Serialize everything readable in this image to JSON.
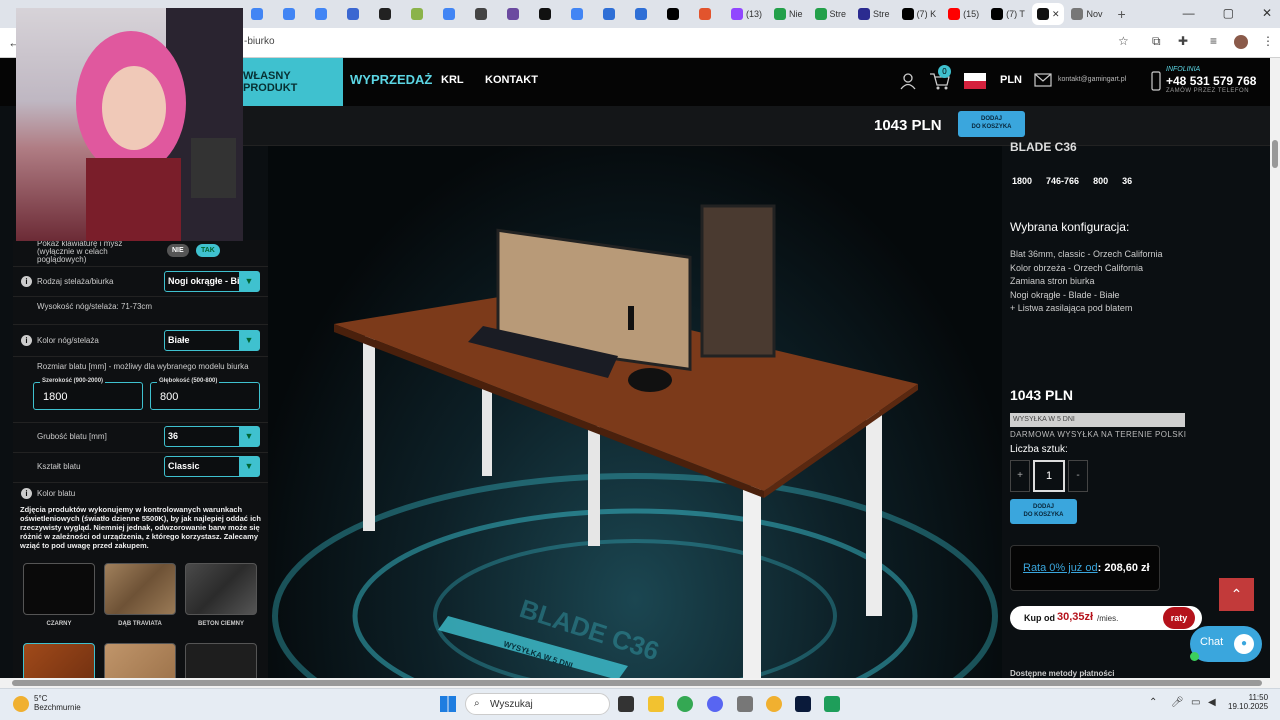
{
  "browser": {
    "tabs": [
      {
        "label": "",
        "color": "#4285f4"
      },
      {
        "label": "",
        "color": "#4285f4"
      },
      {
        "label": "",
        "color": "#4285f4"
      },
      {
        "label": "",
        "color": "#3b67d1"
      },
      {
        "label": "",
        "color": "#222222"
      },
      {
        "label": "",
        "color": "#8bb34a"
      },
      {
        "label": "",
        "color": "#4285f4"
      },
      {
        "label": "",
        "color": "#444444"
      },
      {
        "label": "",
        "color": "#6b4aa0"
      },
      {
        "label": "",
        "color": "#111111"
      },
      {
        "label": "",
        "color": "#4285f4"
      },
      {
        "label": "",
        "color": "#2f6fd6"
      },
      {
        "label": "",
        "color": "#2f6fd6"
      },
      {
        "label": "",
        "color": "#000000"
      },
      {
        "label": "",
        "color": "#e2542d"
      },
      {
        "label": "(13)",
        "color": "#9146ff"
      },
      {
        "label": "Nie",
        "color": "#23a04a"
      },
      {
        "label": "Stre",
        "color": "#23a04a"
      },
      {
        "label": "Stre",
        "color": "#2b2b90"
      },
      {
        "label": "(7) K",
        "color": "#000000"
      },
      {
        "label": "(15)",
        "color": "#ff0000"
      },
      {
        "label": "(7) T",
        "color": "#000000"
      },
      {
        "label": "",
        "color": "#111111"
      },
      {
        "label": "Nov",
        "color": "#777777"
      }
    ],
    "url": "-biurko",
    "new_tab": "+"
  },
  "nav": {
    "own_product": "WŁASNY PRODUKT",
    "sale": "WYPRZEDAŻ",
    "krl": "KRL",
    "contact": "KONTAKT",
    "cart_count": "0",
    "currency": "PLN",
    "email": "kontakt@gamingart.pl",
    "hotline_label": "INFOLINIA",
    "phone": "+48 531 579 768",
    "phone_sub": "ZAMÓW PRZEZ TELEFON"
  },
  "sticky": {
    "price": "1043 PLN",
    "add_top": "DODAJ",
    "add_bottom": "DO KOSZYKA"
  },
  "config": {
    "keyboard_label": "Pokaż klawiaturę i mysz (wyłącznie w celach poglądowych)",
    "keyboard_no": "NIE",
    "keyboard_yes": "TAK",
    "frame_label": "Rodzaj stelaża/biurka",
    "frame_value": "Nogi okrągłe - Bi",
    "height_note": "Wysokość nóg/stelaża: 71-73cm",
    "legs_color_label": "Kolor nóg/stelaża",
    "legs_color_value": "Białe",
    "size_label": "Rozmiar blatu [mm] - możliwy dla wybranego modelu biurka",
    "width_label": "Szerokość (900-2000)",
    "width_value": "1800",
    "depth_label": "Głębokość (500-800)",
    "depth_value": "800",
    "thickness_label": "Grubość blatu [mm]",
    "thickness_value": "36",
    "shape_label": "Kształt blatu",
    "shape_value": "Classic",
    "top_color_label": "Kolor blatu",
    "disclaimer": "Zdjęcia produktów wykonujemy w kontrolowanych warunkach oświetleniowych (światło dzienne 5500K), by jak najlepiej oddać ich rzeczywisty wygląd. Niemniej jednak, odwzorowanie barw może się różnić w zależności od urządzenia, z którego korzystasz. Zalecamy wziąć to pod uwagę przed zakupem.",
    "swatches": [
      {
        "name": "CZARNY",
        "color": "#0a0a0a"
      },
      {
        "name": "DĄB TRAVIATA",
        "color": "#8a6a48"
      },
      {
        "name": "BETON CIEMNY",
        "color": "#3a3a3a"
      }
    ]
  },
  "product": {
    "model": "BLADE C36",
    "dims": [
      "1800",
      "746-766",
      "800",
      "36"
    ],
    "selected_heading": "Wybrana konfiguracja:",
    "selected_lines": [
      "Blat 36mm, classic - Orzech California",
      "Kolor obrzeża - Orzech California",
      "Zamiana stron biurka",
      "Nogi okrągłe - Blade - Białe",
      "+ Listwa zasilająca pod blatem"
    ],
    "price": "1043 PLN",
    "shipping": "WYSYŁKA W 5 DNI",
    "free_shipping": "DARMOWA WYSYŁKA NA TERENIE POLSKI",
    "qty_label": "Liczba sztuk:",
    "qty_minus": "+",
    "qty_value": "1",
    "qty_plus": "-",
    "add_top": "DODAJ",
    "add_bottom": "DO KOSZYKA",
    "rata_link": "Rata 0% już od",
    "rata_value": ": 208,60 zł",
    "kup_label": "Kup od",
    "kup_value": "30,35zł",
    "kup_unit": "/mies.",
    "raty": "raty",
    "payment_methods": "Dostępne metody płatności",
    "chat": "Chat",
    "floor_banner": "BLADE C36",
    "floor_ribbon": "WYSYŁKA W 5 DNI"
  },
  "taskbar": {
    "temp": "5°C",
    "weather": "Bezchmurnie",
    "search": "Wyszukaj",
    "time": "11:50",
    "date": "19.10.2025"
  }
}
